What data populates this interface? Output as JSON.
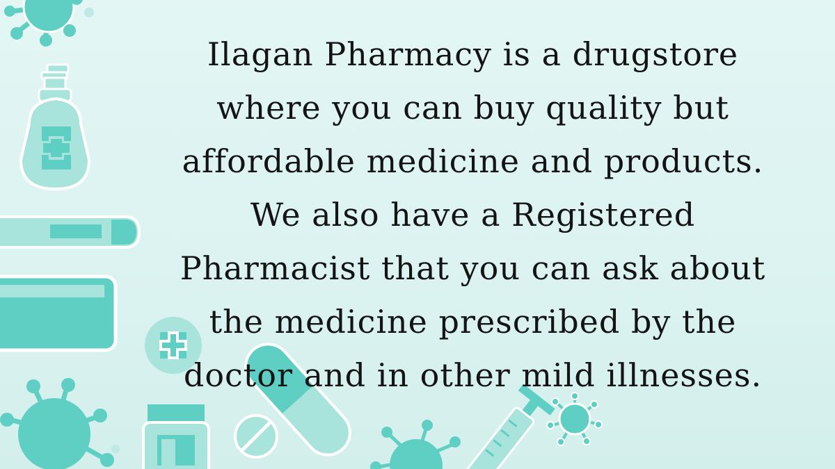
{
  "message": {
    "lines": [
      "Ilagan Pharmacy is a drugstore",
      "where you can buy quality but",
      "affordable medicine and products.",
      "We also have a Registered",
      "Pharmacist that you can ask about",
      "the medicine prescribed by the",
      "doctor and in other mild illnesses."
    ]
  },
  "colors": {
    "background": "#dff5f3",
    "accent": "#5ecfc2",
    "accent_light": "#a8e4dc",
    "outline": "#ffffff",
    "text": "#141414"
  },
  "icons": [
    "virus-icon",
    "soap-pump-bottle-icon",
    "thermometer-icon",
    "medicine-jar-icon",
    "medical-cross-badge-icon",
    "capsule-pill-icon",
    "tablet-pill-icon",
    "syringe-icon"
  ]
}
